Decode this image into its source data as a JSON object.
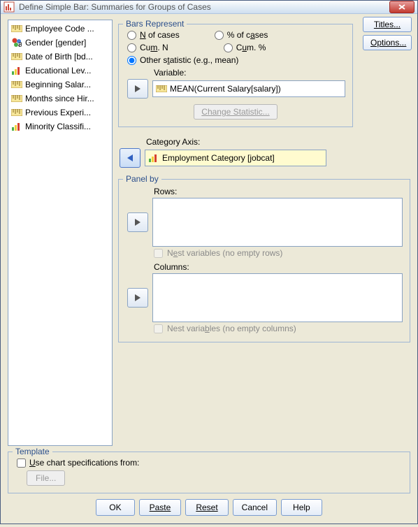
{
  "window": {
    "title": "Define Simple Bar: Summaries for Groups of Cases"
  },
  "sidebar": {
    "items": [
      {
        "label": "Employee Code ...",
        "kind": "scale"
      },
      {
        "label": "Gender [gender]",
        "kind": "nominal"
      },
      {
        "label": "Date of Birth [bd...",
        "kind": "scale"
      },
      {
        "label": "Educational Lev...",
        "kind": "ordinal"
      },
      {
        "label": "Beginning Salar...",
        "kind": "scale"
      },
      {
        "label": "Months since Hir...",
        "kind": "scale"
      },
      {
        "label": "Previous Experi...",
        "kind": "scale"
      },
      {
        "label": "Minority Classifi...",
        "kind": "ordinal"
      }
    ]
  },
  "side_buttons": {
    "titles": "Titles...",
    "options": "Options..."
  },
  "bars": {
    "legend": "Bars Represent",
    "opt_n": {
      "pre": "",
      "u": "N",
      "post": " of cases"
    },
    "opt_pct": {
      "pre": "% of c",
      "u": "a",
      "post": "ses"
    },
    "opt_cumn": {
      "pre": "Cu",
      "u": "m",
      "post": ". N"
    },
    "opt_cumpct": {
      "pre": "C",
      "u": "u",
      "post": "m. %"
    },
    "opt_other": {
      "pre": "Other s",
      "u": "t",
      "post": "atistic (e.g., mean)"
    },
    "selected": "other",
    "variable_label": "Variable:",
    "variable_value": "MEAN(Current Salary[salary])",
    "change_stat": "Change Statistic..."
  },
  "category_axis": {
    "label": "Category Axis:",
    "value": "Employment Category [jobcat]"
  },
  "panel": {
    "legend": "Panel by",
    "rows_label": "Rows:",
    "nest_rows": {
      "pre": "N",
      "u": "e",
      "post": "st variables (no empty rows)"
    },
    "cols_label": "Columns:",
    "nest_cols": {
      "pre": "Nest varia",
      "u": "b",
      "post": "les (no empty columns)"
    }
  },
  "template": {
    "legend": "Template",
    "use_label": {
      "pre": "",
      "u": "U",
      "post": "se chart specifications from:"
    },
    "file_btn": "File..."
  },
  "footer": {
    "ok": "OK",
    "paste": "Paste",
    "reset": "Reset",
    "cancel": "Cancel",
    "help": "Help"
  }
}
